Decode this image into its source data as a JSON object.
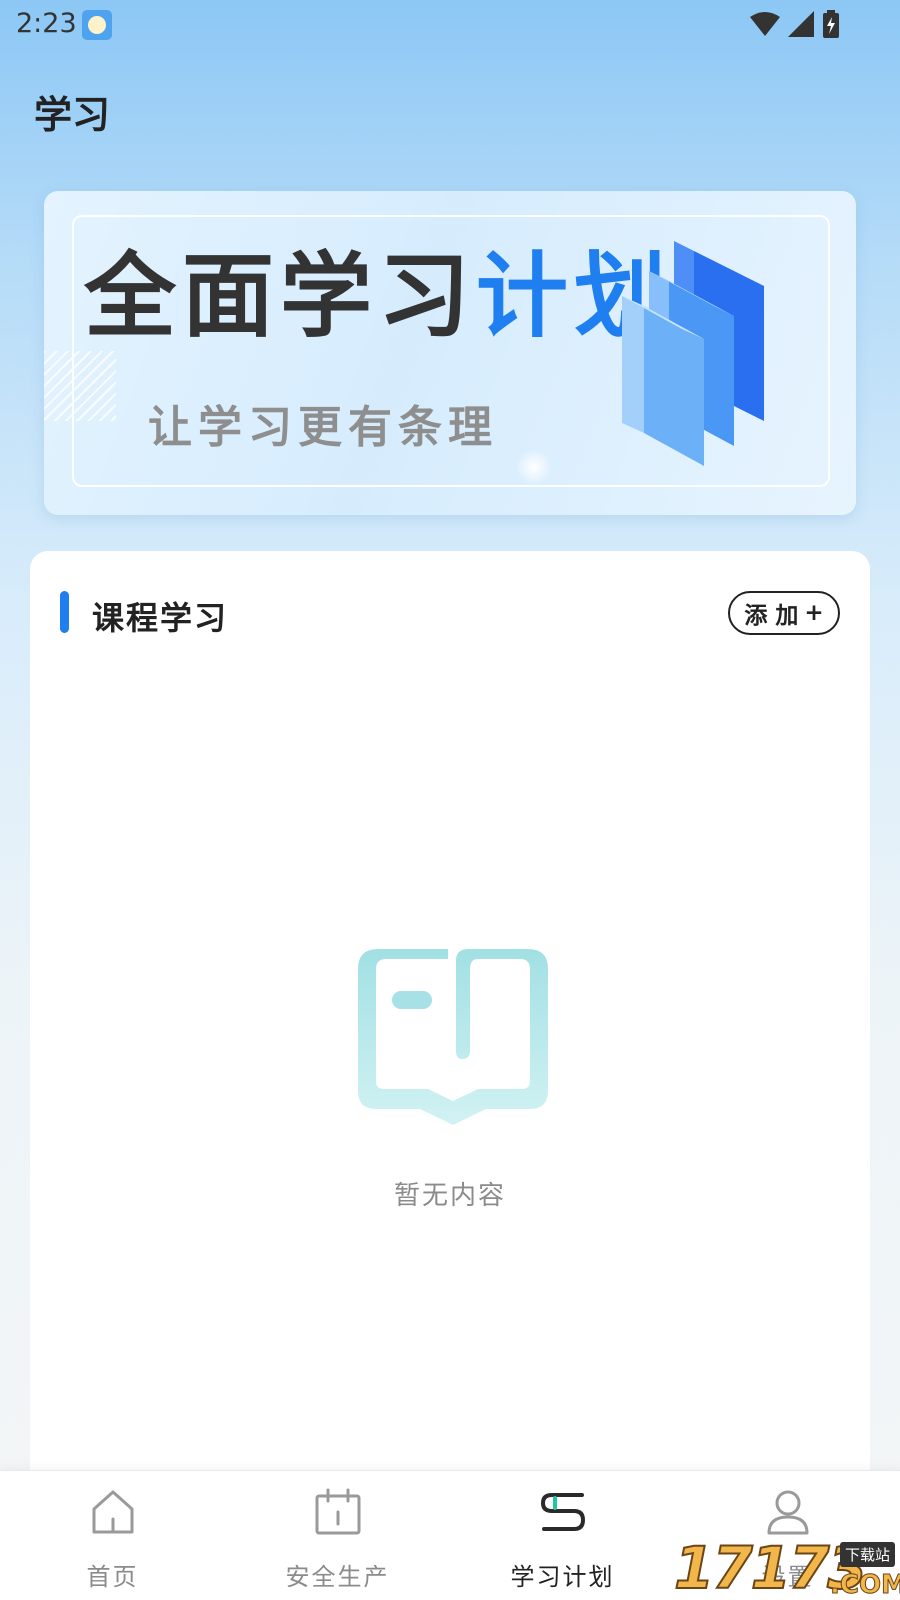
{
  "status_bar": {
    "time": "2:23"
  },
  "header": {
    "title": "学习"
  },
  "banner": {
    "headline_dark": "全面学习",
    "headline_blue": "计划",
    "subtitle": "让学习更有条理"
  },
  "section": {
    "title": "课程学习",
    "add_label": "添 加",
    "add_icon": "+"
  },
  "empty_state": {
    "text": "暂无内容"
  },
  "tabs": [
    {
      "label": "首页",
      "icon": "home-icon",
      "active": false
    },
    {
      "label": "安全生产",
      "icon": "calendar-icon",
      "active": false
    },
    {
      "label": "学习计划",
      "icon": "study-plan-icon",
      "active": true
    },
    {
      "label": "设置",
      "icon": "user-icon",
      "active": false
    }
  ],
  "watermark": {
    "number": "17173",
    "tag": "下载站",
    "suffix": ".COM"
  },
  "colors": {
    "accent": "#1f7ef0",
    "empty_icon": "#a6e3e6",
    "tab_active": "#222222",
    "tab_inactive": "#8b8b8b"
  }
}
